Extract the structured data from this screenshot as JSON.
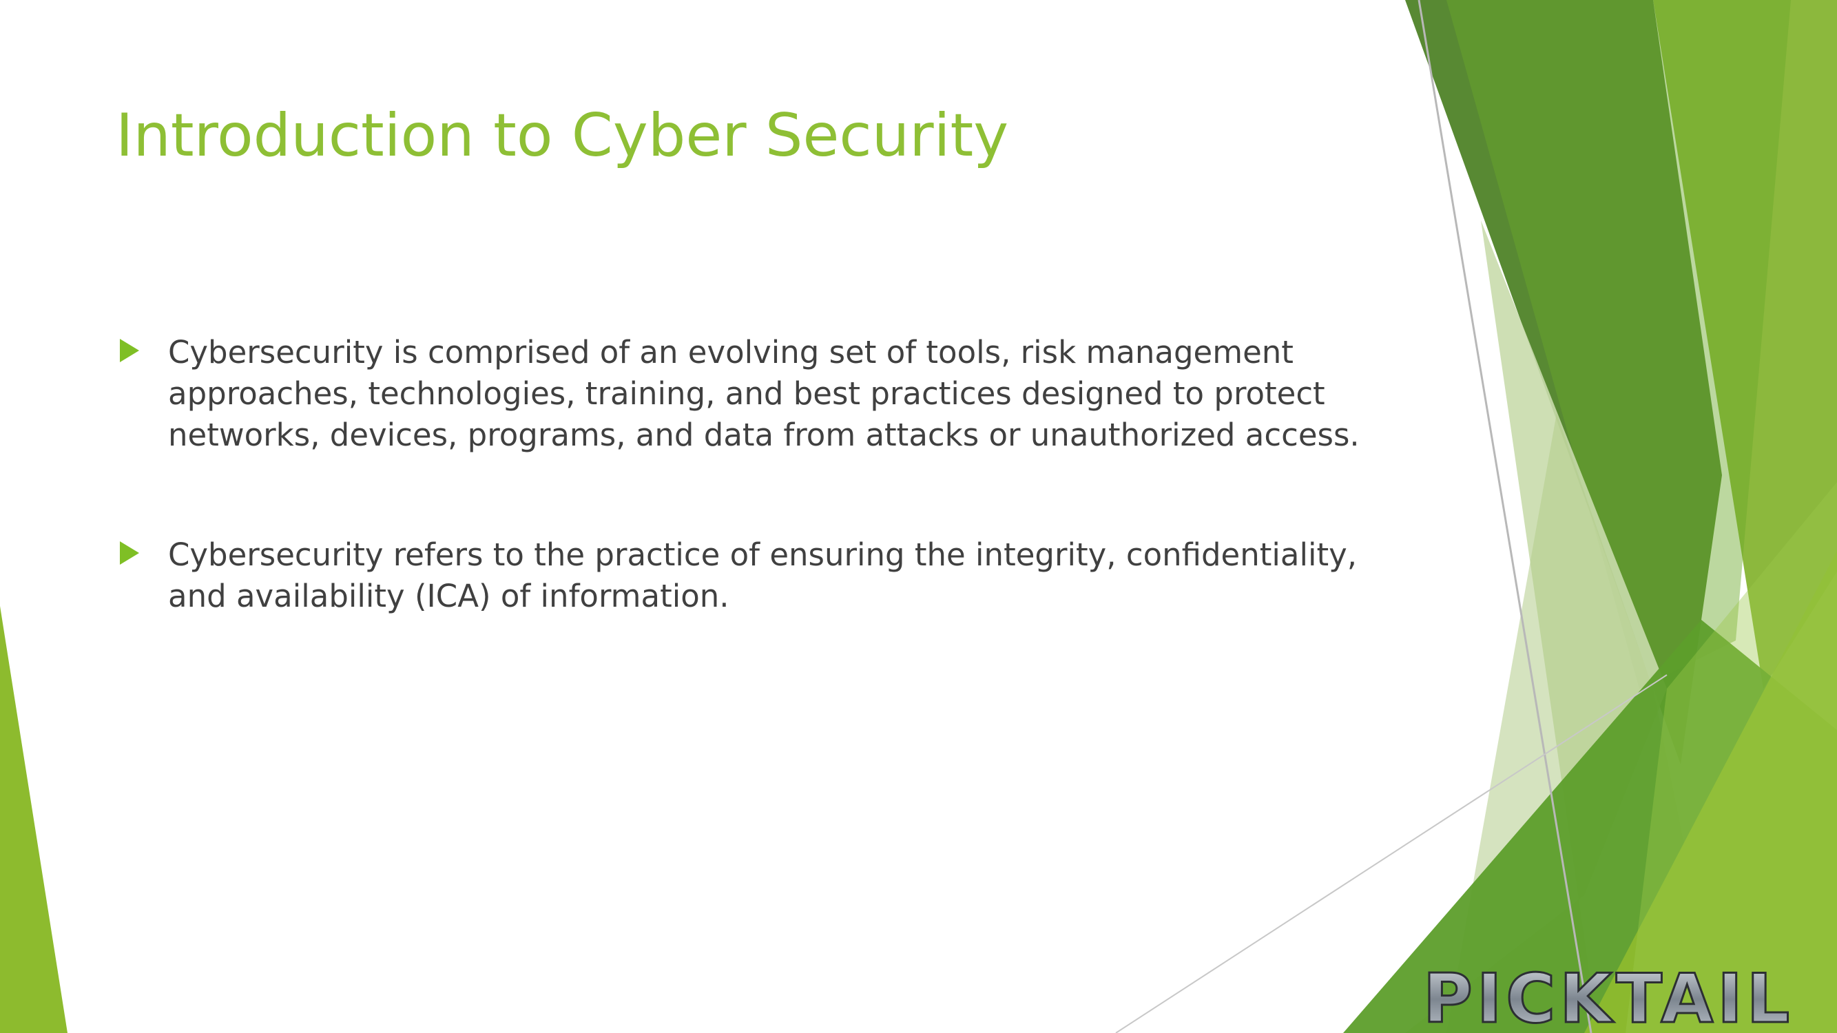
{
  "slide": {
    "title": "Introduction to Cyber Security",
    "bullets": [
      {
        "text": "Cybersecurity is comprised of an evolving set of tools, risk management approaches, technologies, training, and best practices designed to protect networks, devices, programs, and data from attacks or unauthorized access."
      },
      {
        "text": "Cybersecurity refers to the practice of ensuring the integrity, confidentiality, and availability (ICA) of information."
      }
    ]
  },
  "logo": {
    "text": "PICKTAIL"
  },
  "colors": {
    "title": "#8ebf35",
    "bullet": "#7fbf25",
    "body_text": "#404040",
    "dark_green": "#3f7a1d",
    "mid_green": "#6aa82b",
    "light_green": "#9cc74a",
    "pale_green": "#c9dcac"
  }
}
